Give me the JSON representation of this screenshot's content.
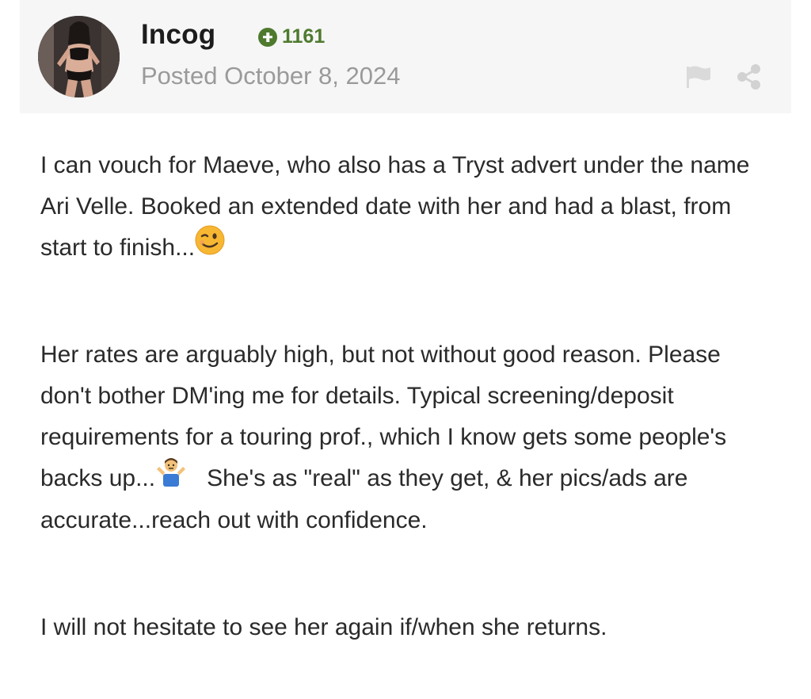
{
  "post": {
    "author": {
      "name": "Incog",
      "reputation": "1161",
      "reputation_icon": "plus-circle-icon"
    },
    "date": "Posted October 8, 2024",
    "actions": {
      "report_icon": "flag-icon",
      "share_icon": "share-icon"
    },
    "body": {
      "paragraph_1_text": "I can vouch for Maeve, who also has a Tryst advert under the name Ari Velle. Booked an extended date with her and had a blast, from start to finish...",
      "paragraph_1_emoji": "winking-face-emoji",
      "paragraph_2_text_a": "Her rates are arguably high, but not without good reason. Please don't bother DM'ing me for details. Typical screening/deposit requirements for a touring prof., which I know gets some people's backs up...",
      "paragraph_2_emoji": "person-shrugging-emoji",
      "paragraph_2_text_b": "   She's as \"real\" as they get, & her pics/ads are accurate...reach out with confidence.",
      "paragraph_3_text": "I will not hesitate to see her again if/when she returns."
    }
  },
  "colors": {
    "header_bg": "#f6f6f6",
    "reputation": "#4e7a2e",
    "muted_text": "#9a9a9a",
    "body_text": "#2a2a2a",
    "icon_gray": "#d6d6d6"
  }
}
